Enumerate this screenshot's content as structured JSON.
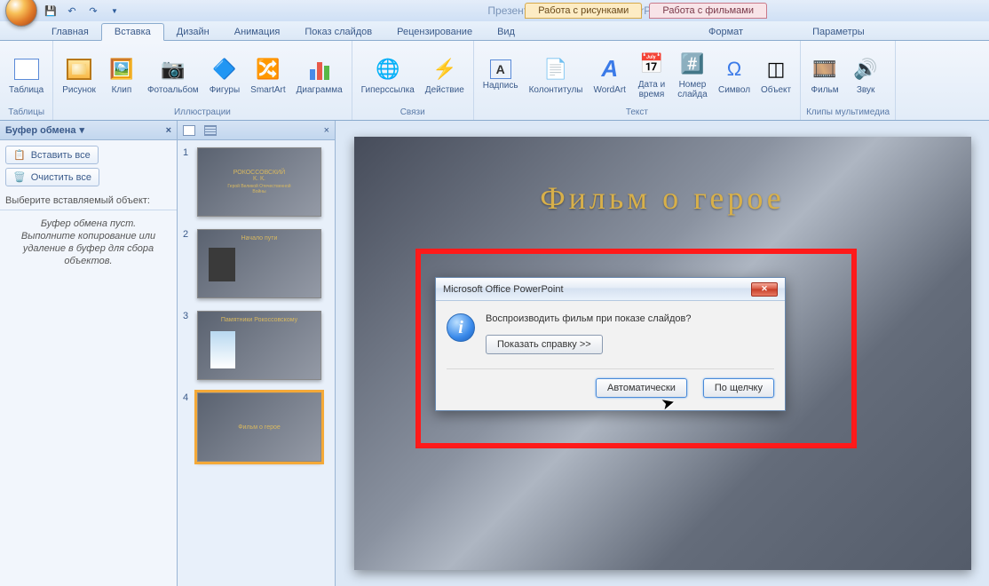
{
  "title": "Презентация1 - Microsoft PowerPoint",
  "context_tabs": {
    "pictures": "Работа с рисунками",
    "movies": "Работа с фильмами"
  },
  "tabs": {
    "home": "Главная",
    "insert": "Вставка",
    "design": "Дизайн",
    "anim": "Анимация",
    "slideshow": "Показ слайдов",
    "review": "Рецензирование",
    "view": "Вид",
    "format": "Формат",
    "params": "Параметры"
  },
  "ribbon": {
    "tables": {
      "label": "Таблицы",
      "table": "Таблица"
    },
    "illustrations": {
      "label": "Иллюстрации",
      "picture": "Рисунок",
      "clip": "Клип",
      "album": "Фотоальбом",
      "shapes": "Фигуры",
      "smartart": "SmartArt",
      "chart": "Диаграмма"
    },
    "links": {
      "label": "Связи",
      "hyperlink": "Гиперссылка",
      "action": "Действие"
    },
    "text": {
      "label": "Текст",
      "textbox": "Надпись",
      "headerfooter": "Колонтитулы",
      "wordart": "WordArt",
      "datetime": "Дата и\nвремя",
      "slidenum": "Номер\nслайда",
      "symbol": "Символ",
      "object": "Объект"
    },
    "media": {
      "label": "Клипы мультимедиа",
      "movie": "Фильм",
      "sound": "Звук"
    }
  },
  "clipboard": {
    "title": "Буфер обмена",
    "paste_all": "Вставить все",
    "clear_all": "Очистить все",
    "choose": "Выберите вставляемый объект:",
    "empty": "Буфер обмена пуст.\nВыполните копирование или\nудаление в буфер для сбора\nобъектов."
  },
  "thumbs": [
    {
      "n": "1",
      "title": "РОКОССОВСКИЙ\nК. К.",
      "sub": "Герой Великой Отечественной\nВойны"
    },
    {
      "n": "2",
      "title": "Начало пути",
      "sub": ""
    },
    {
      "n": "3",
      "title": "Памятники Рокоссовскому",
      "sub": ""
    },
    {
      "n": "4",
      "title": "Фильм о герое",
      "sub": ""
    }
  ],
  "slide": {
    "title": "Фильм о герое"
  },
  "dialog": {
    "title": "Microsoft Office PowerPoint",
    "message": "Воспроизводить фильм при показе слайдов?",
    "help": "Показать справку >>",
    "auto": "Автоматически",
    "onclick": "По щелчку"
  }
}
